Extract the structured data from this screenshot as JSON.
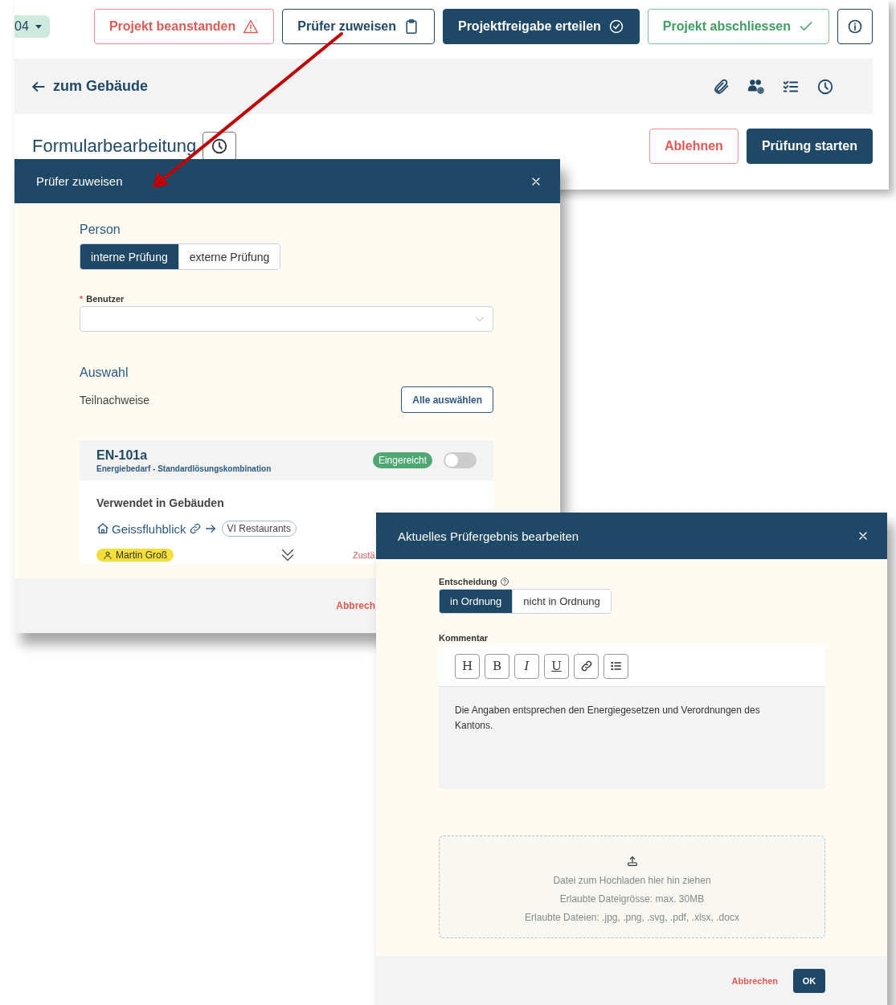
{
  "background_page": {
    "project_selector": "04",
    "actions": [
      {
        "label": "Projekt beanstanden",
        "kind": "danger"
      },
      {
        "label": "Prüfer zuweisen",
        "kind": "outline"
      },
      {
        "label": "Projektfreigabe erteilen",
        "kind": "primary"
      },
      {
        "label": "Projekt abschliessen",
        "kind": "success"
      }
    ],
    "back_link": "zum Gebäude",
    "title": "Formularbearbeitung",
    "buttons": [
      {
        "label": "Ablehnen",
        "kind": "danger"
      },
      {
        "label": "Prüfung starten",
        "kind": "primary"
      }
    ]
  },
  "assign_dialog": {
    "title": "Prüfer zuweisen",
    "person_label": "Person",
    "person_options": [
      {
        "label": "interne Prüfung",
        "selected": true
      },
      {
        "label": "externe Prüfung",
        "selected": false
      }
    ],
    "user_field": {
      "required_mark": "*",
      "label": "Benutzer"
    },
    "selection_heading": "Auswahl",
    "sub_label": "Teilnachweise",
    "select_all_button": "Alle auswählen",
    "item": {
      "code": "EN-101a",
      "description": "Energiebedarf - Standardlösungskombination",
      "status": "Eingereicht",
      "on": false,
      "used_in_label": "Verwendet in Gebäuden",
      "building": "Geissfluhblick",
      "usage": "VI Restaurants",
      "assignee": "Martin Groß",
      "responsibility": "Zustä"
    },
    "cancel_button": "Abbrech"
  },
  "result_dialog": {
    "title": "Aktuelles Prüfergebnis bearbeiten",
    "decision_label": "Entscheidung",
    "decision_options": [
      {
        "label": "in Ordnung",
        "selected": true
      },
      {
        "label": "nicht in Ordnung",
        "selected": false
      }
    ],
    "comment_label": "Kommentar",
    "editor_tools": [
      {
        "kind": "heading",
        "label": "H"
      },
      {
        "kind": "bold",
        "label": "B"
      },
      {
        "kind": "italic",
        "label": "I"
      },
      {
        "kind": "underline",
        "label": "U"
      },
      {
        "kind": "link"
      },
      {
        "kind": "list"
      }
    ],
    "comment_text": "Die Angaben entsprechen den Energiegesetzen und Verordnungen des Kantons.",
    "upload": {
      "hint": "Datei zum Hochladen hier hin ziehen",
      "max_size": "Erlaubte Dateigrösse: max. 30MB",
      "file_types": "Erlaubte Dateien: .jpg, .png, .svg, .pdf, .xlsx, .docx"
    },
    "cancel_button": "Abbrechen",
    "ok_button": "OK"
  }
}
